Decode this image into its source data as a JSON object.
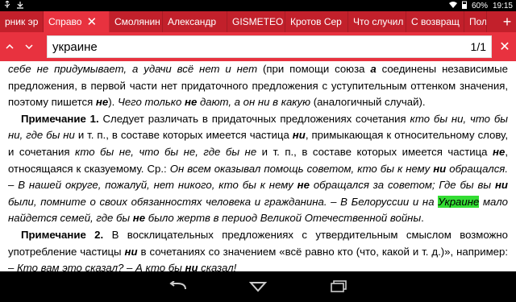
{
  "status_bar": {
    "battery": "60%",
    "time": "19:15"
  },
  "tabs": [
    {
      "label": "рник эр",
      "active": false
    },
    {
      "label": "Справо",
      "active": true
    },
    {
      "label": "Смолянин",
      "active": false
    },
    {
      "label": "Александр",
      "active": false
    },
    {
      "label": "GISMETEO",
      "active": false
    },
    {
      "label": "Кротов Сер",
      "active": false
    },
    {
      "label": "Что случил",
      "active": false
    },
    {
      "label": "С возвращ",
      "active": false
    },
    {
      "label": "Пол",
      "active": false
    }
  ],
  "find": {
    "query": "украине",
    "count": "1/1"
  },
  "article": {
    "p1": {
      "a": "себе не придумывает, а удачи всё нет и нет",
      "b": " (при помощи союза ",
      "c": "а",
      "d": " соединены независимые предложения, в первой части нет придаточного предложения с уступительным оттенком значения, поэтому пишется ",
      "e": "не",
      "f": "). ",
      "g": "Чего только ",
      "h": "не",
      "i": " дают, а он ни в какую",
      "j": " (аналогичный случай)."
    },
    "p2": {
      "label": "Примечание 1.",
      "a": " Следует различать в придаточных предложениях сочетания ",
      "b": "кто бы ни, что бы ни, где бы ни",
      "c": " и т. п., в составе которых имеется частица ",
      "d": "ни",
      "e": ", примыкающая к относительному слову, и сочетания ",
      "f": "кто бы не, что бы не, где бы не",
      "g": " и т. п., в составе которых имеется частица ",
      "h": "не",
      "i": ", относящаяся к сказуемому. Ср.: ",
      "j": "Он всем оказывал помощь советом, кто бы к нему ",
      "k": "ни",
      "l": " обращался. – В нашей округе, пожалуй, нет никого, кто бы к нему ",
      "m": "не",
      "n": " обращался за советом; Где бы вы ",
      "o": "ни",
      "p": " были, помните о своих обязанностях человека и гражданина. – В Белоруссии и на ",
      "q": "Украине",
      "r": " мало найдется семей, где бы ",
      "s": "не",
      "t": " было жертв в период Великой Отечественной войны",
      "u": "."
    },
    "p3": {
      "label": "Примечание 2.",
      "a": " В восклицательных предложениях с утвердительным смыслом возможно употребление частицы ",
      "b": "ни",
      "c": " в сочетаниях со значением «всё равно кто (что, какой и т. д.)», например: – ",
      "d": "Кто вам это сказал? – А кто бы ",
      "e": "ни",
      "f": " сказал!"
    }
  },
  "icons": {
    "back": "back-icon",
    "home": "home-icon",
    "recents": "recents-icon"
  }
}
